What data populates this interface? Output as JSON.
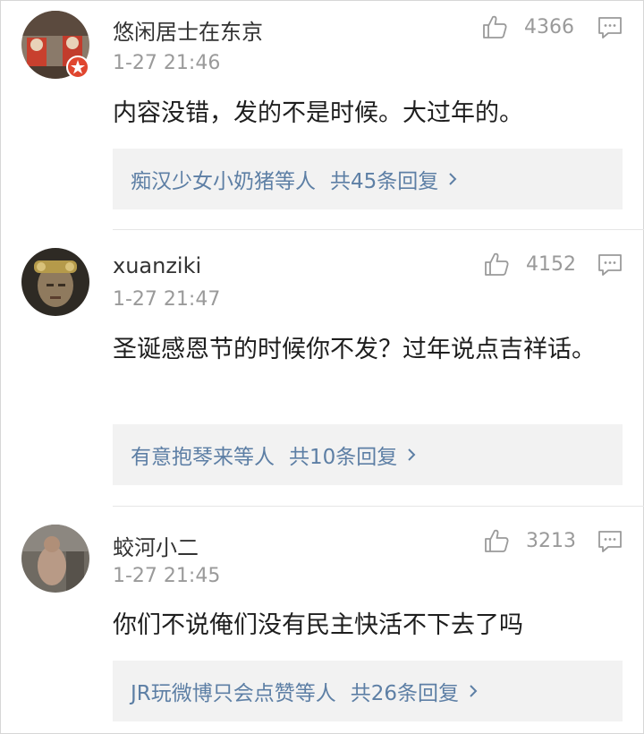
{
  "colors": {
    "link": "#5d7fa5",
    "meta": "#9a9a9a",
    "reply_bg": "#f2f2f2"
  },
  "comments": [
    {
      "username": "悠闲居士在东京",
      "time": "1-27 21:46",
      "likes": "4366",
      "text": "内容没错，发的不是时候。大过年的。",
      "reply": {
        "names": "痴汉少女小奶猪等人",
        "count": "共45条回复"
      },
      "avatar_icon": "avatar-image",
      "badge_icon": "star-badge-icon"
    },
    {
      "username": "xuanziki",
      "time": "1-27 21:47",
      "likes": "4152",
      "text": "圣诞感恩节的时候你不发？过年说点吉祥话。",
      "reply": {
        "names": "有意抱琴来等人",
        "count": "共10条回复"
      },
      "avatar_icon": "avatar-image"
    },
    {
      "username": "蛟河小二",
      "time": "1-27 21:45",
      "likes": "3213",
      "text": "你们不说俺们没有民主快活不下去了吗",
      "reply": {
        "names": "JR玩微博只会点赞等人",
        "count": "共26条回复"
      },
      "avatar_icon": "avatar-image"
    }
  ]
}
